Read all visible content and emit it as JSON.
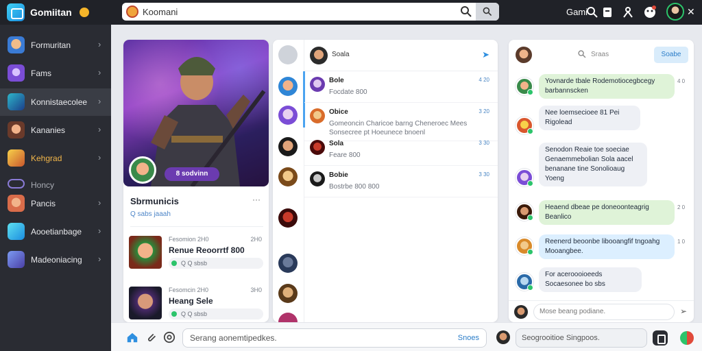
{
  "app": {
    "title": "Gomiitan",
    "search_value": "Koomani",
    "right_label": "Gami"
  },
  "sidebar": {
    "items": [
      {
        "label": "Formuritan",
        "icon": "user-avatar-icon",
        "color": "#3a7bd5"
      },
      {
        "label": "Fams",
        "icon": "game-icon",
        "color": "#7b4dd6"
      },
      {
        "label": "Konnistaecolee",
        "icon": "community-icon",
        "color": "#2db5c9"
      },
      {
        "label": "Kananies",
        "icon": "character-icon",
        "color": "#c9572d"
      },
      {
        "label": "Kehgrad",
        "icon": "flame-icon",
        "color": "#e8a63a",
        "highlight": true
      },
      {
        "label": "Honcy",
        "icon": "gamepad-icon",
        "color": "#8a7bd6"
      },
      {
        "label": "Pancis",
        "icon": "hero-icon",
        "color": "#d96c4a"
      },
      {
        "label": "Aooetianbage",
        "icon": "globe-icon",
        "color": "#2db5c9"
      },
      {
        "label": "Madeoniacing",
        "icon": "trophy-icon",
        "color": "#4a6fd6"
      }
    ]
  },
  "feature": {
    "badge": "8 sodvinn",
    "title": "Sbrmunicis",
    "subtitle": "Q sabs jaaah",
    "more": "···",
    "posts": [
      {
        "meta": "Fesomion 2H0",
        "time": "2H0",
        "title": "Renue Reoorrtf 800",
        "stats": "Q Q sbsb"
      },
      {
        "meta": "Fesomcin 2H0",
        "time": "3H0",
        "title": "Heang Sele",
        "stats": "Q Q sbsb"
      }
    ]
  },
  "chatlist": {
    "header": "Soala",
    "conversations": [
      {
        "name": "Bole",
        "preview": "Focdate 800",
        "time": "4 20"
      },
      {
        "name": "Obice",
        "preview": "Gomeoncin Charicoe barng Cheneroec Mees Sonsecree pt Hoeunece bnoenl",
        "time": "3 20"
      },
      {
        "name": "Sola",
        "preview": "Feare 800",
        "time": "3 30"
      },
      {
        "name": "Bobie",
        "preview": "Bostrbe 800 800",
        "time": "3 30"
      }
    ]
  },
  "chat": {
    "search_label": "Sraas",
    "button_label": "Soabe",
    "messages": [
      {
        "text": "Yovnarde tbale Rodemotiocegbcegy barbannscken",
        "time": "4 0",
        "style": "green"
      },
      {
        "text": "Nee loemsecioee 81 Pei Rigolead",
        "time": "",
        "style": "grey"
      },
      {
        "text": "Senodon Reaie toe soeciae Genaemmebolian Sola aacel benanane tine Sonolioaug Yoeng",
        "time": "",
        "style": "grey"
      },
      {
        "text": "Heaend dbeae pe doneoonteagrig Beanlico",
        "time": "2 0",
        "style": "green"
      },
      {
        "text": "Reenerd beoonbe libooangfif tngoahg Mooangbee.",
        "time": "1 0",
        "style": "blue"
      },
      {
        "text": "For aceroooioeeds Socaesonee bo sbs",
        "time": "",
        "style": "grey"
      }
    ],
    "input_placeholder": "Mose beang podiane."
  },
  "bottombar": {
    "placeholder": "Serang aonemtipedkes.",
    "send_label": "Snoes",
    "secondary_placeholder": "Seogrooitioe Singpoos."
  }
}
